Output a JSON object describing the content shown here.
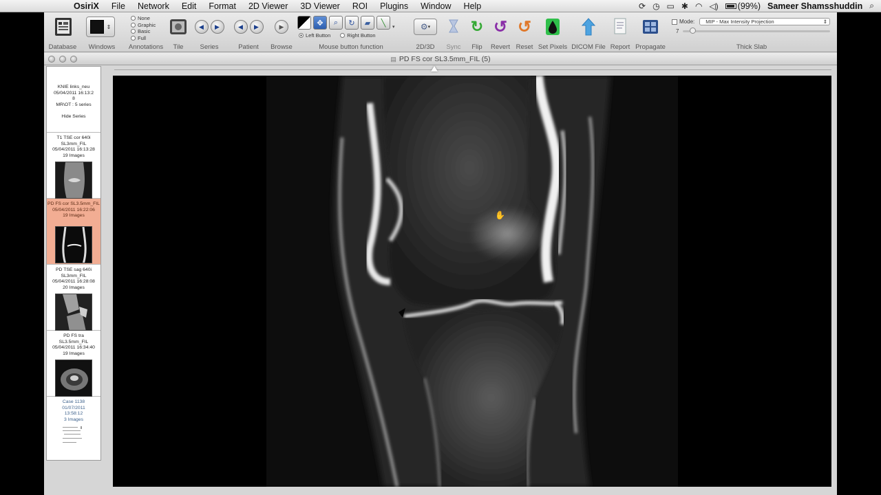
{
  "menubar": {
    "app_name": "OsiriX",
    "items": [
      "File",
      "Network",
      "Edit",
      "Format",
      "2D Viewer",
      "3D Viewer",
      "ROI",
      "Plugins",
      "Window",
      "Help"
    ],
    "battery": "(99%)",
    "user": "Sameer Shamsshuddin"
  },
  "toolbar": {
    "database": "Database",
    "windows": "Windows",
    "annotations": "Annotations",
    "annotation_options": [
      "None",
      "Graphic",
      "Basic",
      "Full"
    ],
    "tile": "Tile",
    "series": "Series",
    "patient": "Patient",
    "browse": "Browse",
    "mouse_button_function": "Mouse button function",
    "left_button": "Left Button",
    "right_button": "Right Button",
    "two_d_three_d": "2D/3D",
    "sync": "Sync",
    "flip": "Flip",
    "revert": "Revert",
    "reset": "Reset",
    "set_pixels": "Set Pixels",
    "dicom_file": "DICOM File",
    "report": "Report",
    "propagate": "Propagate",
    "thick_slab": "Thick Slab",
    "mode_label": "Mode:",
    "mode_value": "MIP - Max Intensity Projection",
    "slab_value": "7"
  },
  "viewer": {
    "window_title": "PD FS cor SL3.5mm_FIL (5)"
  },
  "study": {
    "name": "KNIE links_neu",
    "date": "05/04/2011 16:13:2",
    "date_tail": "8",
    "modality": "MR\\OT : 5 series",
    "hide_label": "Hide Series"
  },
  "series": [
    {
      "name": "T1 TSE cor 640i",
      "name2": "SL3mm_FIL",
      "date": "05/04/2011 16:13:28",
      "count": "19 Images"
    },
    {
      "name": "PD FS cor SL3.5mm_FIL",
      "name2": "",
      "date": "05/04/2011 16:22:06",
      "count": "19 Images"
    },
    {
      "name": "PD TSE sag 640i",
      "name2": "SL3mm_FIL",
      "date": "05/04/2011 16:28:08",
      "count": "20 Images"
    },
    {
      "name": "PD FS tra",
      "name2": "SL3.5mm_FIL",
      "date": "05/04/2011 16:34:40",
      "count": "19 Images"
    },
    {
      "name": "Case 1138",
      "name2": "01/07/2011",
      "date": "13:58:12",
      "count": "3 Images"
    }
  ]
}
